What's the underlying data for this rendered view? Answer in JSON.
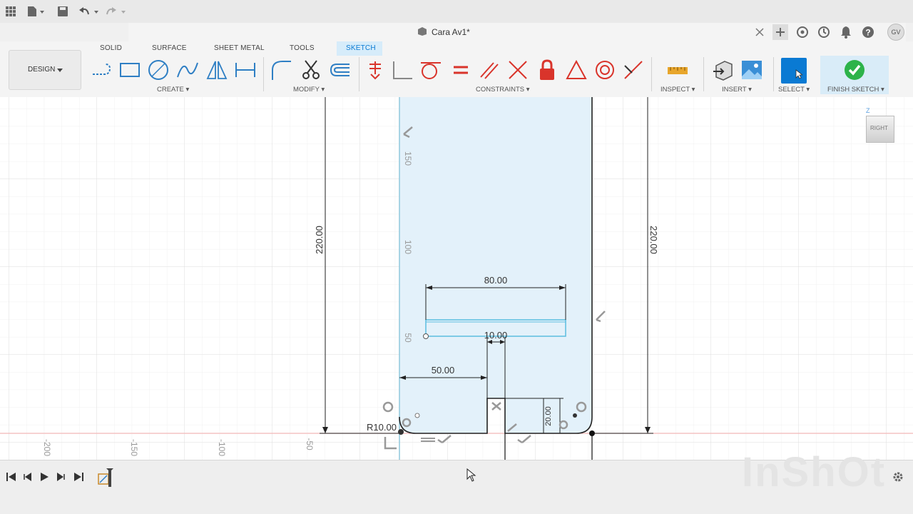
{
  "window": {
    "title": "Cara Av1*",
    "user_initials": "GV"
  },
  "tabs": [
    "SOLID",
    "SURFACE",
    "SHEET METAL",
    "TOOLS",
    "SKETCH"
  ],
  "active_tab": "SKETCH",
  "workspace": {
    "label": "DESIGN"
  },
  "groups": {
    "create": "CREATE",
    "modify": "MODIFY",
    "constraints": "CONSTRAINTS",
    "inspect": "INSPECT",
    "insert": "INSERT",
    "select": "SELECT",
    "finish": "FINISH SKETCH"
  },
  "colors": {
    "accent": "#0a7ad3",
    "finish_green": "#2db34a",
    "constraint_red": "#d9342b"
  },
  "viewcube": {
    "face": "RIGHT",
    "axis_label": "Z"
  },
  "sketch": {
    "dims": {
      "height_left": "220.00",
      "height_right": "220.00",
      "width_top": "80.00",
      "slot_width": "10.00",
      "offset": "50.00",
      "small_height": "20.00",
      "radius": "R10.00"
    },
    "ruler_v": [
      "150",
      "100",
      "50"
    ],
    "ruler_h": [
      "-200",
      "-150",
      "-100",
      "-50"
    ]
  },
  "watermark": "InShOt"
}
